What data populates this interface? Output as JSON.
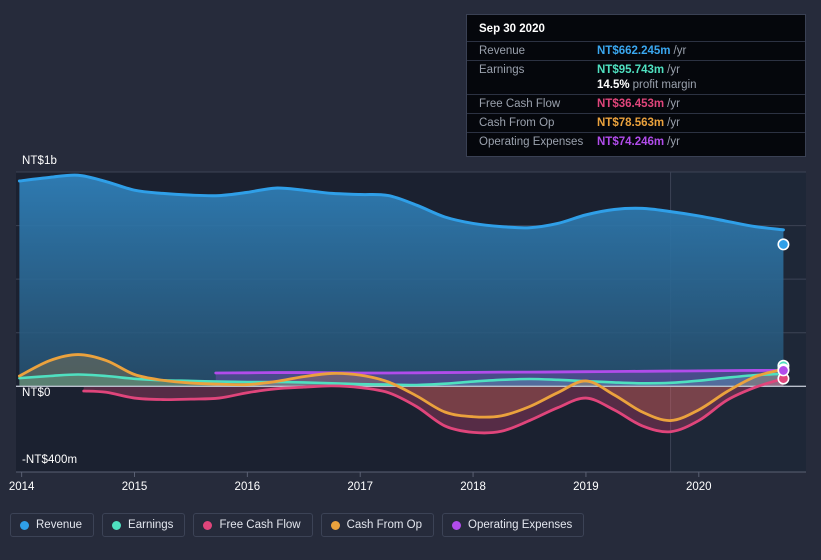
{
  "tooltip": {
    "date": "Sep 30 2020",
    "rows": [
      {
        "key": "Revenue",
        "value": "NT$662.245m",
        "unit": "/yr",
        "color": "#3aa7ef"
      },
      {
        "key": "Earnings",
        "value": "NT$95.743m",
        "unit": "/yr",
        "color": "#4fe0c0"
      },
      {
        "key": "",
        "value": "14.5%",
        "unit": "profit margin",
        "color": "#ffffff"
      },
      {
        "key": "Free Cash Flow",
        "value": "NT$36.453m",
        "unit": "/yr",
        "color": "#e0457b"
      },
      {
        "key": "Cash From Op",
        "value": "NT$78.563m",
        "unit": "/yr",
        "color": "#eba23d"
      },
      {
        "key": "Operating Expenses",
        "value": "NT$74.246m",
        "unit": "/yr",
        "color": "#b14ceb"
      }
    ]
  },
  "axes": {
    "y_top_label": "NT$1b",
    "y_zero_label": "NT$0",
    "y_bottom_label": "-NT$400m",
    "x_labels": [
      "2014",
      "2015",
      "2016",
      "2017",
      "2018",
      "2019",
      "2020"
    ]
  },
  "legend": [
    {
      "label": "Revenue",
      "color": "#2f9fe8"
    },
    {
      "label": "Earnings",
      "color": "#4fe0c0"
    },
    {
      "label": "Free Cash Flow",
      "color": "#e0457b"
    },
    {
      "label": "Cash From Op",
      "color": "#eba23d"
    },
    {
      "label": "Operating Expenses",
      "color": "#b14ceb"
    }
  ],
  "chart_data": {
    "type": "area",
    "title": "",
    "xlabel": "",
    "ylabel": "",
    "ylim": [
      -400,
      1000
    ],
    "y_unit": "NT$ millions",
    "grid": true,
    "legend_position": "bottom-left",
    "x_tick_values": [
      2014,
      2015,
      2016,
      2017,
      2018,
      2019,
      2020
    ],
    "x_range": [
      2013.95,
      2020.95
    ],
    "forecast_divider_x": 2019.75,
    "series": [
      {
        "name": "Revenue",
        "color": "#2f9fe8",
        "filled": true,
        "x": [
          2013.98,
          2014.25,
          2014.5,
          2014.75,
          2015.0,
          2015.25,
          2015.5,
          2015.75,
          2016.0,
          2016.25,
          2016.5,
          2016.75,
          2017.0,
          2017.25,
          2017.5,
          2017.75,
          2018.0,
          2018.25,
          2018.5,
          2018.75,
          2019.0,
          2019.25,
          2019.5,
          2019.75,
          2020.0,
          2020.25,
          2020.5,
          2020.75
        ],
        "values": [
          958,
          975,
          985,
          955,
          915,
          900,
          892,
          890,
          905,
          925,
          915,
          900,
          895,
          890,
          845,
          790,
          760,
          745,
          740,
          760,
          800,
          825,
          830,
          815,
          795,
          770,
          745,
          730
        ]
      },
      {
        "name": "Earnings",
        "color": "#4fe0c0",
        "filled": true,
        "x": [
          2013.98,
          2014.25,
          2014.5,
          2014.75,
          2015.0,
          2015.25,
          2015.5,
          2015.75,
          2016.0,
          2016.25,
          2016.5,
          2016.75,
          2017.0,
          2017.25,
          2017.5,
          2017.75,
          2018.0,
          2018.25,
          2018.5,
          2018.75,
          2019.0,
          2019.25,
          2019.5,
          2019.75,
          2020.0,
          2020.25,
          2020.5,
          2020.75
        ],
        "values": [
          38,
          48,
          55,
          48,
          35,
          28,
          25,
          22,
          20,
          20,
          18,
          14,
          10,
          8,
          6,
          12,
          22,
          30,
          34,
          30,
          24,
          18,
          14,
          16,
          26,
          40,
          52,
          58
        ]
      },
      {
        "name": "Free Cash Flow",
        "color": "#e0457b",
        "filled": true,
        "x": [
          2014.55,
          2014.75,
          2015.0,
          2015.25,
          2015.5,
          2015.75,
          2016.0,
          2016.25,
          2016.5,
          2016.75,
          2017.0,
          2017.25,
          2017.5,
          2017.75,
          2018.0,
          2018.25,
          2018.5,
          2018.75,
          2019.0,
          2019.25,
          2019.5,
          2019.75,
          2020.0,
          2020.25,
          2020.5,
          2020.75
        ],
        "values": [
          -22,
          -28,
          -55,
          -62,
          -60,
          -55,
          -30,
          -12,
          -4,
          2,
          -6,
          -30,
          -95,
          -185,
          -215,
          -210,
          -160,
          -100,
          -55,
          -110,
          -185,
          -212,
          -160,
          -65,
          -5,
          36
        ]
      },
      {
        "name": "Cash From Op",
        "color": "#eba23d",
        "filled": true,
        "x": [
          2013.98,
          2014.25,
          2014.5,
          2014.75,
          2015.0,
          2015.25,
          2015.5,
          2015.75,
          2016.0,
          2016.25,
          2016.5,
          2016.75,
          2017.0,
          2017.25,
          2017.5,
          2017.75,
          2018.0,
          2018.25,
          2018.5,
          2018.75,
          2019.0,
          2019.25,
          2019.5,
          2019.75,
          2020.0,
          2020.25,
          2020.5,
          2020.75
        ],
        "values": [
          48,
          120,
          148,
          120,
          55,
          28,
          15,
          10,
          8,
          22,
          45,
          60,
          52,
          20,
          -45,
          -120,
          -142,
          -138,
          -95,
          -30,
          25,
          -40,
          -120,
          -160,
          -110,
          -25,
          45,
          79
        ]
      },
      {
        "name": "Operating Expenses",
        "color": "#b14ceb",
        "filled": true,
        "x": [
          2015.72,
          2016.0,
          2016.25,
          2016.5,
          2016.75,
          2017.0,
          2017.25,
          2017.5,
          2017.75,
          2018.0,
          2018.25,
          2018.5,
          2018.75,
          2019.0,
          2019.25,
          2019.5,
          2019.75,
          2020.0,
          2020.25,
          2020.5,
          2020.75
        ],
        "values": [
          62,
          63,
          64,
          64,
          63,
          62,
          62,
          63,
          64,
          65,
          66,
          66,
          67,
          68,
          69,
          70,
          71,
          72,
          73,
          74,
          74
        ]
      }
    ],
    "endpoints": [
      {
        "name": "Revenue",
        "x": 2020.75,
        "value": 662
      },
      {
        "name": "Earnings",
        "x": 2020.75,
        "value": 96
      },
      {
        "name": "Free Cash Flow",
        "x": 2020.75,
        "value": 36
      },
      {
        "name": "Cash From Op",
        "x": 2020.75,
        "value": 79
      },
      {
        "name": "Operating Expenses",
        "x": 2020.75,
        "value": 74
      }
    ]
  }
}
